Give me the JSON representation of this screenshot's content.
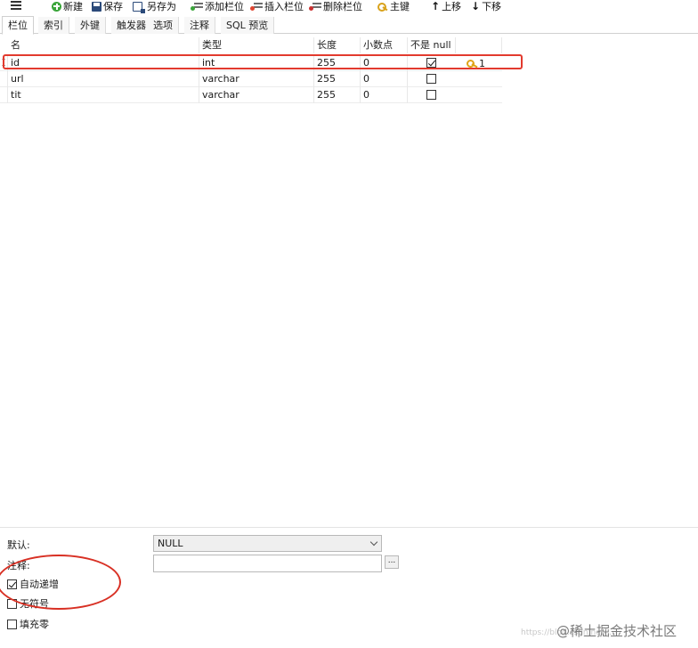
{
  "toolbar": {
    "new": "新建",
    "save": "保存",
    "save_as": "另存为",
    "add_field": "添加栏位",
    "insert_field": "插入栏位",
    "delete_field": "删除栏位",
    "primary_key": "主键",
    "move_up": "上移",
    "move_down": "下移"
  },
  "tabs": [
    "栏位",
    "索引",
    "外键",
    "触发器",
    "选项",
    "注释",
    "SQL 预览"
  ],
  "grid": {
    "headers": [
      "名",
      "类型",
      "长度",
      "小数点",
      "不是 null"
    ],
    "rows": [
      {
        "name": "id",
        "type": "int",
        "length": "255",
        "decimals": "0",
        "not_null": true,
        "key": "1",
        "marker": "I"
      },
      {
        "name": "url",
        "type": "varchar",
        "length": "255",
        "decimals": "0",
        "not_null": false,
        "key": "",
        "marker": ""
      },
      {
        "name": "tit",
        "type": "varchar",
        "length": "255",
        "decimals": "0",
        "not_null": false,
        "key": "",
        "marker": ""
      }
    ]
  },
  "properties": {
    "default_label": "默认:",
    "default_value": "NULL",
    "comment_label": "注释:",
    "comment_value": "",
    "more_button": "...",
    "auto_increment_label": "自动递增",
    "auto_increment": true,
    "unsigned_label": "无符号",
    "unsigned": false,
    "zerofill_label": "填充零",
    "zerofill": false
  },
  "watermark": {
    "text": "@稀土掘金技术社区",
    "faint": "https://blog.csdn.net/..."
  },
  "colors": {
    "highlight": "#e23a2e",
    "key": "#e0a417"
  }
}
